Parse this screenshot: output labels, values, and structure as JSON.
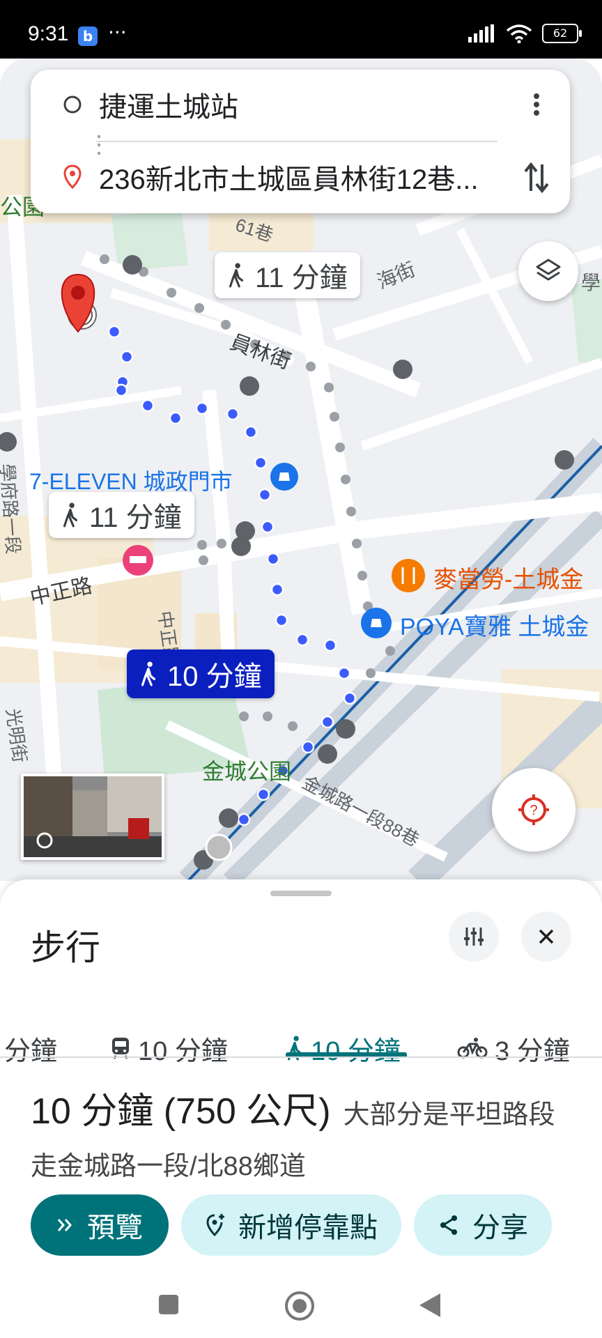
{
  "status_bar": {
    "time": "9:31",
    "app_badge": "b",
    "more": "···",
    "battery": "62"
  },
  "search": {
    "origin": "捷運土城站",
    "destination": "236新北市土城區員林街12巷..."
  },
  "map": {
    "route_bubbles": {
      "alt1": "11 分鐘",
      "alt2": "11 分鐘",
      "selected": "10 分鐘"
    },
    "labels": {
      "park_top": "公園",
      "lane_61": "61巷",
      "road_right_top": "學",
      "road_right_mid": "海街",
      "yuanlin": "員林街",
      "seven_eleven": "7-ELEVEN 城政門市",
      "zhongzheng_left": "中正路",
      "zhongzheng_vert": "中正路",
      "mcdonalds": "麥當勞-土城金",
      "poya": "POYA寶雅 土城金",
      "jincheng_park": "金城公園",
      "jincheng_rd": "金城路一段88巷",
      "guangming": "光明街",
      "left_vert": "學府路一段"
    }
  },
  "sheet": {
    "title": "步行",
    "tabs": [
      {
        "label": "分鐘",
        "icon": "car-icon"
      },
      {
        "label": "10 分鐘",
        "icon": "transit-icon"
      },
      {
        "label": "10 分鐘",
        "icon": "walk-icon"
      },
      {
        "label": "3 分鐘",
        "icon": "bike-icon"
      }
    ],
    "summary_main": "10 分鐘 (750 公尺)",
    "summary_sub": "大部分是平坦路段",
    "via": "走金城路一段/北88鄉道",
    "actions": {
      "preview": "預覽",
      "add_stop": "新增停靠點",
      "share": "分享"
    }
  },
  "colors": {
    "accent": "#00737a",
    "route": "#3b5bfd",
    "selected_bubble": "#0b1fbf",
    "pin": "#ea4335"
  }
}
